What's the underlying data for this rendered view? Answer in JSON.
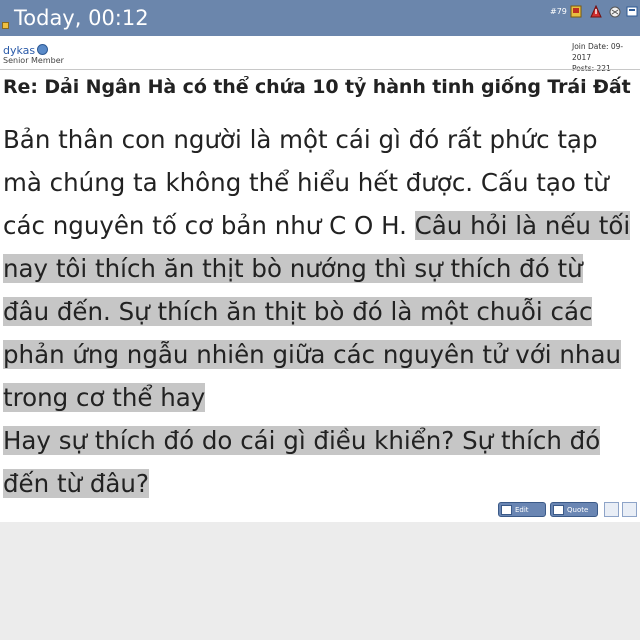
{
  "header": {
    "date": "Today, 00:12",
    "post_number": "#79"
  },
  "user": {
    "name": "dykas",
    "title": "Senior Member",
    "join_date": "Join Date: 09-2017",
    "posts": "Posts: 221"
  },
  "post": {
    "title": "Re: Dải Ngân Hà có thể chứa 10 tỷ hành tinh giống Trái Đất",
    "lines": [
      {
        "plain": "Bản thân con người là một cái gì đó rất phức tạp",
        "highlight": ""
      },
      {
        "plain": "mà chúng ta không thể hiểu hết được. Cấu tạo từ",
        "highlight": ""
      },
      {
        "plain": "các nguyên tố cơ bản như C O H. ",
        "highlight": "Câu hỏi là nếu tối"
      },
      {
        "plain": "",
        "highlight": "nay tôi thích ăn thịt bò nướng thì sự thích đó từ"
      },
      {
        "plain": "",
        "highlight": "đâu đến. Sự thích ăn thịt bò đó là một chuỗi các"
      },
      {
        "plain": "",
        "highlight": "phản ứng ngẫu nhiên giữa các nguyên tử với nhau"
      },
      {
        "plain": "",
        "highlight": "trong cơ thể hay"
      },
      {
        "plain": "",
        "highlight": "Hay sự thích đó do cái gì điều khiển? Sự thích đó"
      },
      {
        "plain": "",
        "highlight": "đến từ đâu?"
      }
    ]
  },
  "buttons": {
    "edit": "Edit",
    "quote": "Quote"
  },
  "colors": {
    "header_bg": "#6b86ac",
    "highlight_bg": "#c6c6c6",
    "username": "#2a5aa8"
  }
}
